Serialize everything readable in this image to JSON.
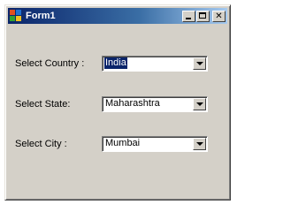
{
  "window": {
    "title": "Form1",
    "minimize_icon": "minimize-icon",
    "maximize_icon": "maximize-icon",
    "close_icon": "close-icon",
    "close_glyph": "✕"
  },
  "form": {
    "country": {
      "label": "Select Country :",
      "value": "India"
    },
    "state": {
      "label": "Select State:",
      "value": "Maharashtra"
    },
    "city": {
      "label": "Select City :",
      "value": "Mumbai"
    }
  },
  "colors": {
    "titlebar_start": "#0a246a",
    "titlebar_end": "#a6caf0",
    "face": "#d4d0c8",
    "selection": "#0a246a"
  }
}
